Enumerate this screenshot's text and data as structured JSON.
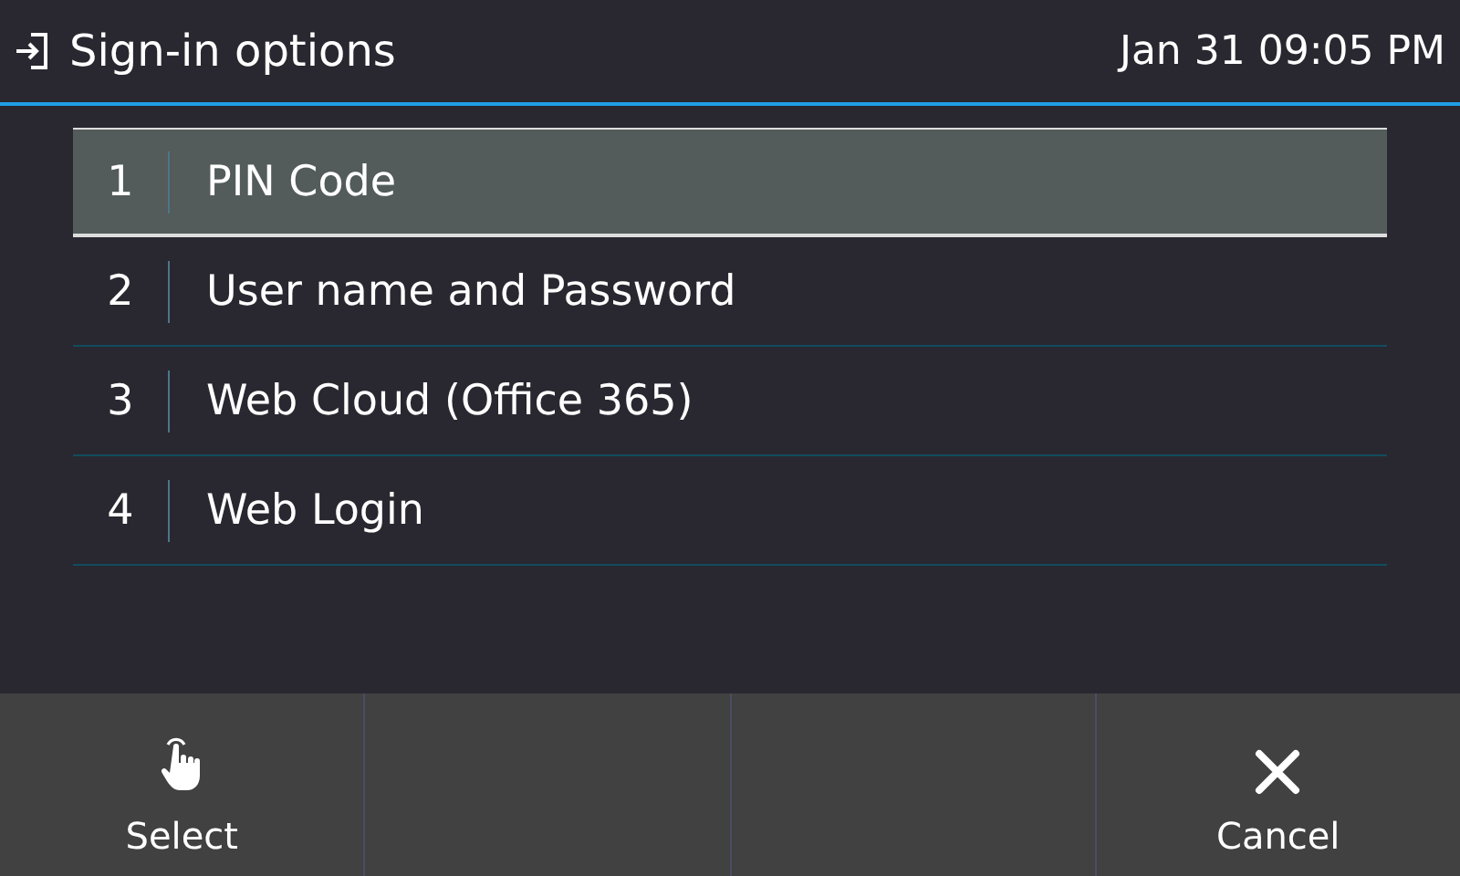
{
  "header": {
    "title": "Sign-in options",
    "datetime": "Jan 31 09:05 PM"
  },
  "options": [
    {
      "number": "1",
      "label": "PIN Code",
      "selected": true
    },
    {
      "number": "2",
      "label": "User name and Password",
      "selected": false
    },
    {
      "number": "3",
      "label": "Web Cloud (Office 365)",
      "selected": false
    },
    {
      "number": "4",
      "label": "Web Login",
      "selected": false
    }
  ],
  "softkeys": [
    {
      "kind": "select",
      "label": "Select"
    },
    {
      "kind": "empty"
    },
    {
      "kind": "empty"
    },
    {
      "kind": "cancel",
      "label": "Cancel"
    }
  ]
}
